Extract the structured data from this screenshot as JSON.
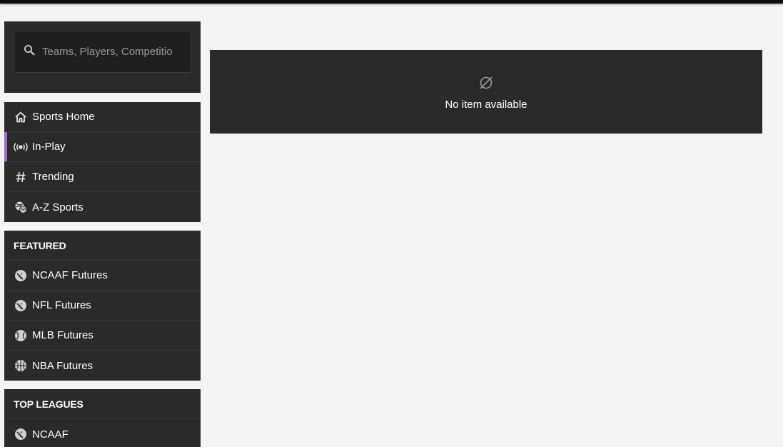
{
  "search": {
    "placeholder": "Teams, Players, Competitio"
  },
  "nav": [
    {
      "label": "Sports Home",
      "icon": "home-icon",
      "active": false
    },
    {
      "label": "In-Play",
      "icon": "live-broadcast-icon",
      "active": true
    },
    {
      "label": "Trending",
      "icon": "hashtag-icon",
      "active": false
    },
    {
      "label": "A-Z Sports",
      "icon": "sports-balls-icon",
      "active": false
    }
  ],
  "featured": {
    "title": "FEATURED",
    "items": [
      {
        "label": "NCAAF Futures",
        "icon": "football-icon"
      },
      {
        "label": "NFL Futures",
        "icon": "football-icon"
      },
      {
        "label": "MLB Futures",
        "icon": "baseball-icon"
      },
      {
        "label": "NBA Futures",
        "icon": "basketball-icon"
      }
    ]
  },
  "top_leagues": {
    "title": "TOP LEAGUES",
    "items": [
      {
        "label": "NCAAF",
        "icon": "football-icon"
      }
    ]
  },
  "main": {
    "empty_message": "No item available",
    "empty_icon": "empty-set-icon"
  },
  "colors": {
    "background": "#f4f4f4",
    "panel": "#2a2a2a",
    "accent": "#9b6bd8",
    "text": "#ffffff",
    "placeholder": "#9a9a9a"
  }
}
